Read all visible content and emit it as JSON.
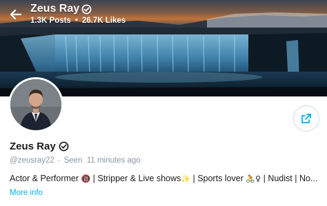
{
  "header": {
    "name": "Zeus Ray",
    "posts": "1.3K Posts",
    "separator": "•",
    "likes": "26.7K Likes"
  },
  "profile": {
    "name": "Zeus Ray",
    "handle": "@zeusray22",
    "separator": "·",
    "seen": "Seen  11 minutes ago",
    "bio_part1": "Actor & Performer ",
    "bio_emoji1": "🔞",
    "bio_part2": " | Stripper & Live shows",
    "bio_emoji2": "✨",
    "bio_part3": " | Sports lover ",
    "bio_emoji3": "🚴♀",
    "bio_part4": " | Nudist | No...",
    "more_info": "More info"
  },
  "icons": {
    "back": "arrow-left-icon",
    "verified": "verified-badge-icon",
    "share": "share-icon"
  },
  "colors": {
    "accent": "#00aff0",
    "muted": "#8a96a3",
    "text": "#1b1b1b"
  }
}
